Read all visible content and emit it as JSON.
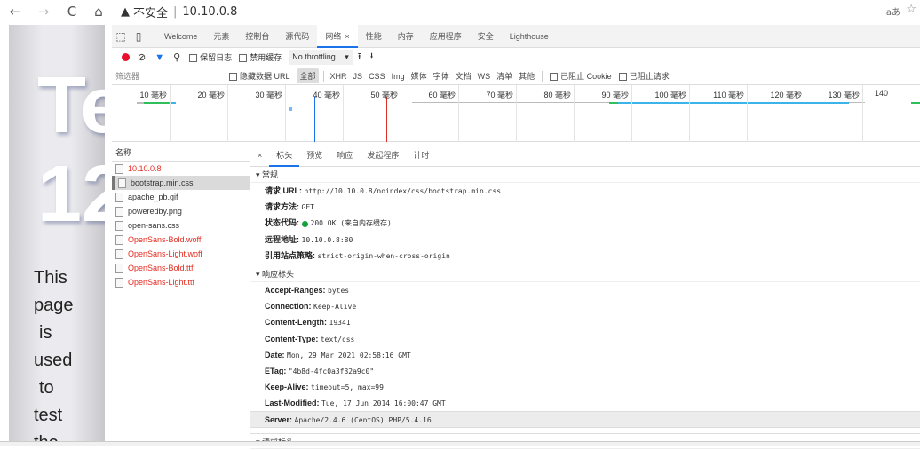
{
  "browser": {
    "back_icon": "←",
    "forward_icon": "→",
    "reload_icon": "C",
    "home_icon": "⌂",
    "warning_icon": "▲",
    "security_label": "不安全",
    "separator": "|",
    "url": "10.10.0.8",
    "read_aloud": "aあ",
    "favorite_icon": "☆"
  },
  "page": {
    "heading_line1": "Te",
    "heading_line2": "12",
    "body_words": [
      "This",
      "page",
      "is",
      "used",
      "to",
      "test",
      "the"
    ]
  },
  "devtools": {
    "tabs": [
      {
        "label": "Welcome"
      },
      {
        "label": "元素"
      },
      {
        "label": "控制台"
      },
      {
        "label": "源代码"
      },
      {
        "label": "网络",
        "active": true,
        "close": "×"
      },
      {
        "label": "性能"
      },
      {
        "label": "内存"
      },
      {
        "label": "应用程序"
      },
      {
        "label": "安全"
      },
      {
        "label": "Lighthouse"
      }
    ],
    "toolbar": {
      "preserve_log": "保留日志",
      "disable_cache": "禁用缓存",
      "throttling": "No throttling",
      "upload_icon": "⭱",
      "download_icon": "⭳"
    },
    "filter": {
      "placeholder": "筛选器",
      "hide_data_urls": "隐藏数据 URL",
      "types": [
        "全部",
        "XHR",
        "JS",
        "CSS",
        "Img",
        "媒体",
        "字体",
        "文档",
        "WS",
        "清单",
        "其他"
      ],
      "active_type": "全部",
      "blocked_cookies": "已阻止 Cookie",
      "blocked_requests": "已阻止请求"
    },
    "timeline_ticks": [
      "10 毫秒",
      "20 毫秒",
      "30 毫秒",
      "40 毫秒",
      "50 毫秒",
      "60 毫秒",
      "70 毫秒",
      "80 毫秒",
      "90 毫秒",
      "100 毫秒",
      "110 毫秒",
      "120 毫秒",
      "130 毫秒",
      "140"
    ],
    "request_list": {
      "header": "名称",
      "items": [
        {
          "name": "10.10.0.8",
          "error": true
        },
        {
          "name": "bootstrap.min.css",
          "selected": true
        },
        {
          "name": "apache_pb.gif"
        },
        {
          "name": "poweredby.png"
        },
        {
          "name": "open-sans.css"
        },
        {
          "name": "OpenSans-Bold.woff",
          "error": true
        },
        {
          "name": "OpenSans-Light.woff",
          "error": true
        },
        {
          "name": "OpenSans-Bold.ttf",
          "error": true
        },
        {
          "name": "OpenSans-Light.ttf",
          "error": true
        }
      ]
    },
    "details": {
      "close": "×",
      "tabs": [
        "标头",
        "预览",
        "响应",
        "发起程序",
        "计时"
      ],
      "active_tab": "标头",
      "general_title": "▾ 常规",
      "general": [
        {
          "key": "请求 URL:",
          "value": "http://10.10.0.8/noindex/css/bootstrap.min.css"
        },
        {
          "key": "请求方法:",
          "value": "GET"
        },
        {
          "key": "状态代码:",
          "value": "200 OK (来自内存缓存)",
          "status_dot": "#0fa33b"
        },
        {
          "key": "远程地址:",
          "value": "10.10.0.8:80"
        },
        {
          "key": "引用站点策略:",
          "value": "strict-origin-when-cross-origin"
        }
      ],
      "response_title": "▾ 响应标头",
      "response_headers": [
        {
          "key": "Accept-Ranges:",
          "value": "bytes"
        },
        {
          "key": "Connection:",
          "value": "Keep-Alive"
        },
        {
          "key": "Content-Length:",
          "value": "19341"
        },
        {
          "key": "Content-Type:",
          "value": "text/css"
        },
        {
          "key": "Date:",
          "value": "Mon, 29 Mar 2021 02:58:16 GMT"
        },
        {
          "key": "ETag:",
          "value": "\"4b8d-4fc0a3f32a9c0\""
        },
        {
          "key": "Keep-Alive:",
          "value": "timeout=5, max=99"
        },
        {
          "key": "Last-Modified:",
          "value": "Tue, 17 Jun 2014 16:00:47 GMT"
        },
        {
          "key": "Server:",
          "value": "Apache/2.4.6 (CentOS) PHP/5.4.16",
          "highlight": true
        }
      ],
      "request_title": "▾ 请求标头"
    }
  }
}
